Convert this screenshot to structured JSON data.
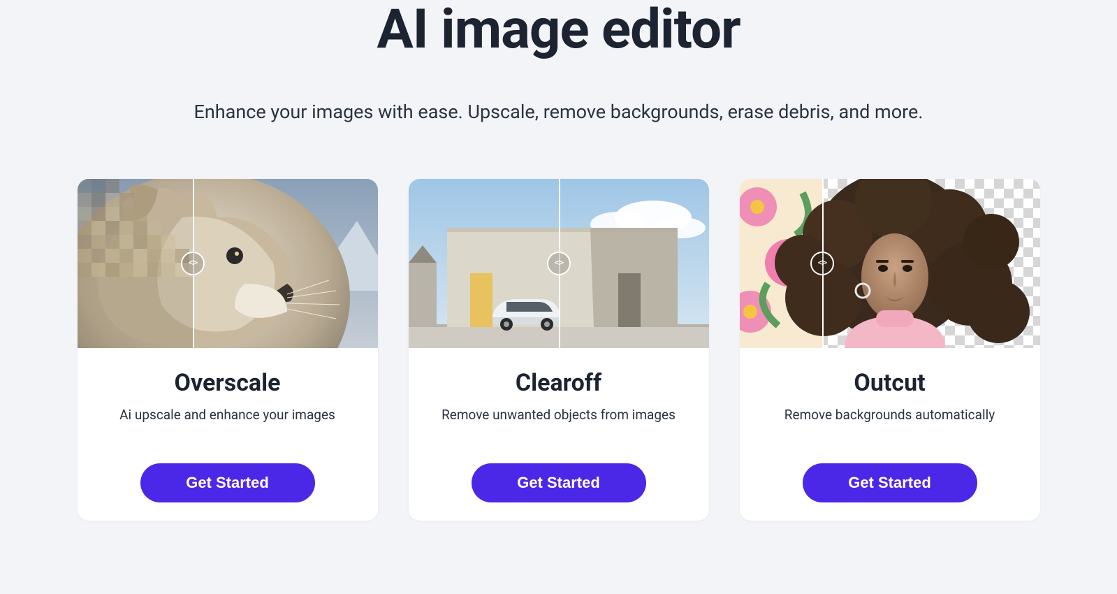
{
  "header": {
    "title": "AI image editor",
    "subtitle": "Enhance your images with ease. Upscale, remove backgrounds, erase debris, and more."
  },
  "cards": [
    {
      "title": "Overscale",
      "description": "Ai upscale and enhance your images",
      "cta": "Get Started",
      "slider_name": "compare-slider-icon"
    },
    {
      "title": "Clearoff",
      "description": "Remove unwanted objects from images",
      "cta": "Get Started",
      "slider_name": "compare-slider-icon"
    },
    {
      "title": "Outcut",
      "description": "Remove backgrounds automatically",
      "cta": "Get Started",
      "slider_name": "compare-slider-icon"
    }
  ],
  "colors": {
    "accent": "#4b27e8",
    "page_bg": "#f3f4f7",
    "card_bg": "#ffffff",
    "text_primary": "#1b2430"
  }
}
